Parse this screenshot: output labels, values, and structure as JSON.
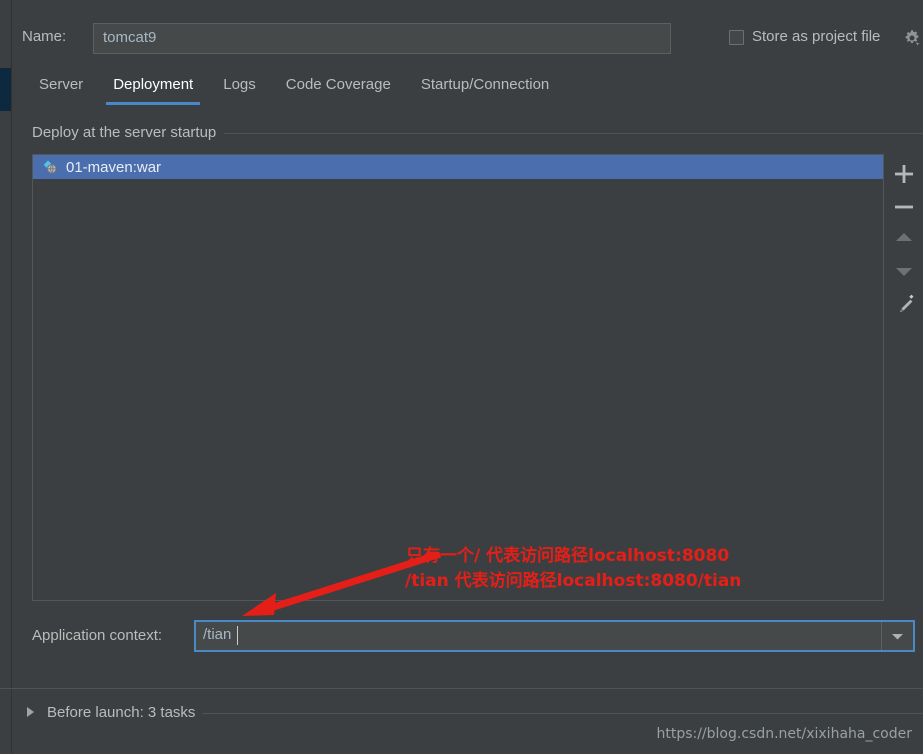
{
  "theme": {
    "background": "#3c3f41",
    "field_background": "#45494a",
    "text": "#bbbbbb",
    "field_text": "#a9b7c6",
    "accent_blue": "#4a88c7",
    "selection_blue": "#4b6eaf",
    "annotation_red": "#e51f17",
    "border": "#545658"
  },
  "header": {
    "name_label": "Name:",
    "name_value": "tomcat9",
    "store_as_project_file_label": "Store as project file",
    "store_as_project_file_checked": false,
    "gear_icon": "gear-icon"
  },
  "tabs": [
    {
      "label": "Server",
      "active": false
    },
    {
      "label": "Deployment",
      "active": true
    },
    {
      "label": "Logs",
      "active": false
    },
    {
      "label": "Code Coverage",
      "active": false
    },
    {
      "label": "Startup/Connection",
      "active": false
    }
  ],
  "deployment": {
    "group_title": "Deploy at the server startup",
    "artifacts": [
      {
        "name": "01-maven:war",
        "icon": "artifact-war-icon",
        "selected": true
      }
    ],
    "toolbar": [
      {
        "name": "add-artifact-button",
        "icon": "plus-icon",
        "enabled": true
      },
      {
        "name": "remove-artifact-button",
        "icon": "minus-icon",
        "enabled": true
      },
      {
        "name": "move-up-button",
        "icon": "arrow-up-icon",
        "enabled": false
      },
      {
        "name": "move-down-button",
        "icon": "arrow-down-icon",
        "enabled": false
      },
      {
        "name": "edit-artifact-button",
        "icon": "pencil-icon",
        "enabled": true
      }
    ]
  },
  "application_context": {
    "label": "Application context:",
    "value": "/tian",
    "placeholder": "",
    "focused": true,
    "dropdown_icon": "chevron-down-icon"
  },
  "annotation": {
    "line1": "只有一个/ 代表访问路径localhost:8080",
    "line2": "/tian 代表访问路径localhost:8080/tian",
    "arrow": "red-arrow-pointing-to-application-context-field"
  },
  "before_launch": {
    "label": "Before launch: 3 tasks",
    "expanded": false,
    "expander_icon": "triangle-right-icon"
  },
  "watermark": "https://blog.csdn.net/xixihaha_coder"
}
